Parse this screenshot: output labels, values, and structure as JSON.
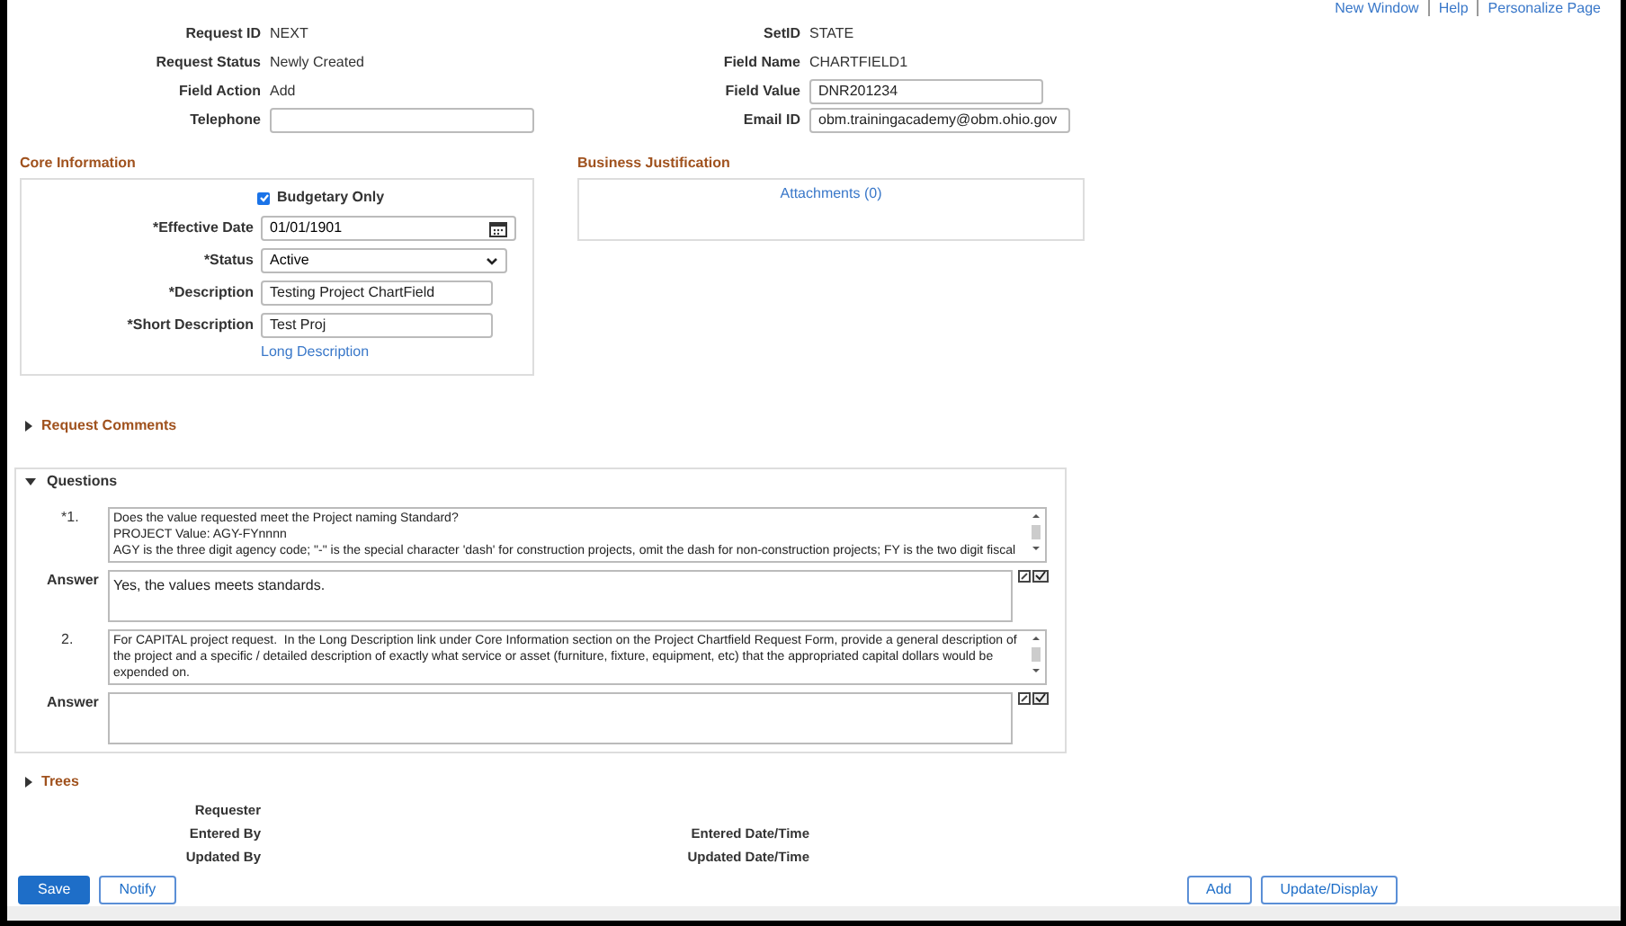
{
  "header_links": [
    "New Window",
    "Help",
    "Personalize Page"
  ],
  "header_left": [
    {
      "label": "Request ID",
      "value": "NEXT",
      "kind": "text"
    },
    {
      "label": "Request Status",
      "value": "Newly Created",
      "kind": "text"
    },
    {
      "label": "Field Action",
      "value": "Add",
      "kind": "text"
    },
    {
      "label": "Telephone",
      "kind": "input"
    }
  ],
  "header_right": [
    {
      "label": "SetID",
      "value": "STATE",
      "kind": "text"
    },
    {
      "label": "Field Name",
      "value": "CHARTFIELD1",
      "kind": "text"
    },
    {
      "label": "Field Value",
      "value": "DNR201234",
      "kind": "input"
    },
    {
      "label": "Email ID",
      "value": "obm.trainingacademy@obm.ohio.gov",
      "kind": "input"
    }
  ],
  "core_information": {
    "title": "Core Information",
    "budgetary_only": {
      "label": "Budgetary Only",
      "checked": true
    },
    "fields": [
      {
        "label": "*Effective Date",
        "value": "01/01/1901",
        "kind": "date"
      },
      {
        "label": "*Status",
        "value": "Active",
        "kind": "select"
      },
      {
        "label": "*Description",
        "value": "Testing Project ChartField",
        "kind": "input"
      },
      {
        "label": "*Short Description",
        "value": "Test Proj",
        "kind": "input"
      }
    ],
    "link": "Long Description"
  },
  "business_justification": {
    "title": "Business Justification",
    "link": "Attachments (0)"
  },
  "request_comments": {
    "title": "Request Comments",
    "expanded": false
  },
  "questions": {
    "title": "Questions",
    "expanded": true,
    "items": [
      {
        "number": "*1.",
        "question": "Does the value requested meet the Project naming Standard?\nPROJECT Value: AGY-FYnnnn\nAGY is the three digit agency code; \"-\" is the special character 'dash' for construction projects, omit the dash for non-construction projects; FY is the two digit fiscal",
        "answer_label": "Answer",
        "answer": "Yes, the values meets standards."
      },
      {
        "number": "2.",
        "question": "For CAPITAL project request.  In the Long Description link under Core Information section on the Project Chartfield Request Form, provide a general description of the project and a specific / detailed description of exactly what service or asset (furniture, fixture, equipment, etc) that the appropriated capital dollars would be expended on.",
        "answer_label": "Answer"
      }
    ]
  },
  "trees": {
    "title": "Trees",
    "expanded": false
  },
  "audit_left": [
    "Requester",
    "Entered By",
    "Updated By"
  ],
  "audit_right": [
    "Entered Date/Time",
    "Updated Date/Time"
  ],
  "buttons_left": [
    {
      "label": "Save",
      "kind": "primary"
    },
    {
      "label": "Notify",
      "kind": "secondary"
    }
  ],
  "buttons_right": [
    {
      "label": "Add",
      "kind": "secondary"
    },
    {
      "label": "Update/Display",
      "kind": "secondary"
    }
  ]
}
